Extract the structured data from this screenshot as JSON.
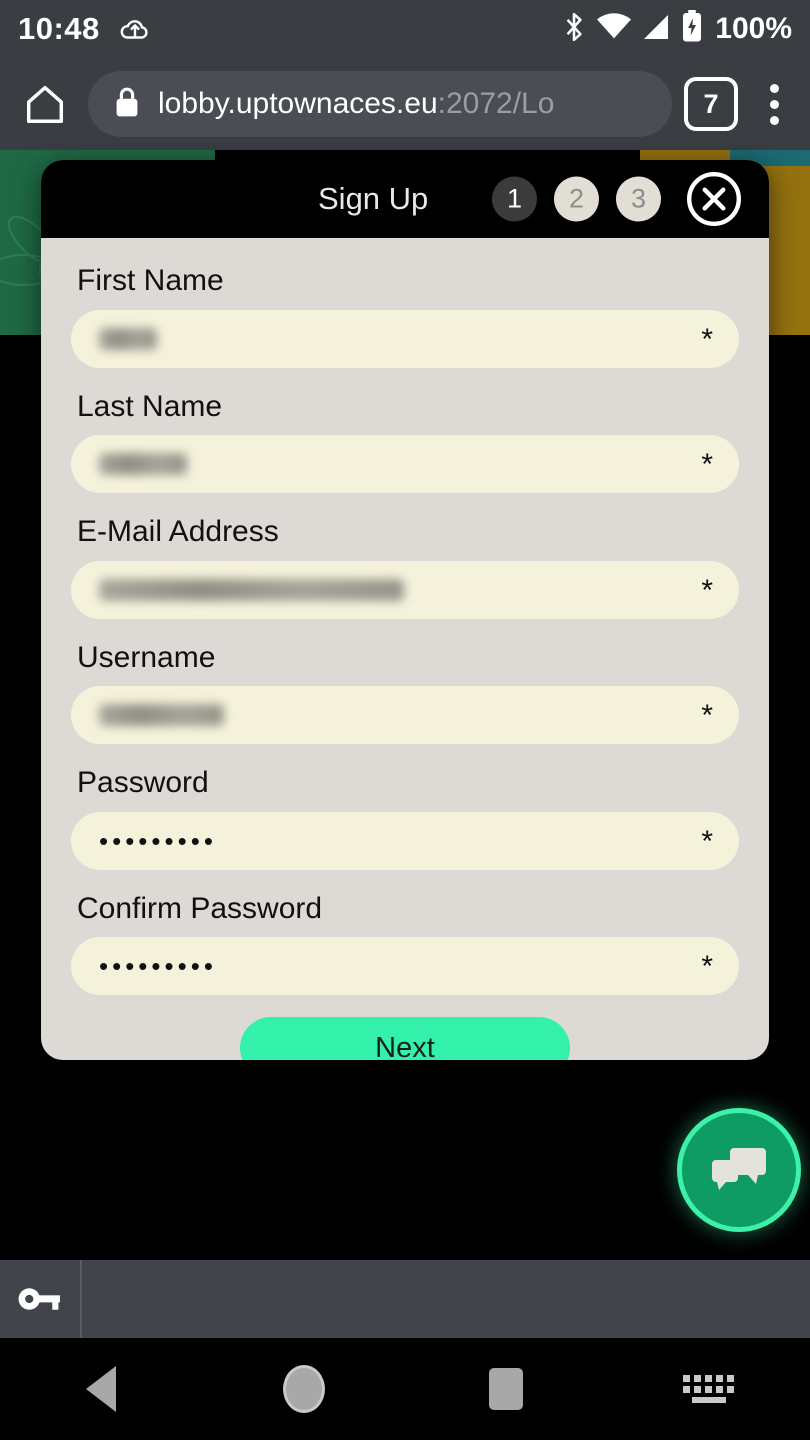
{
  "status_bar": {
    "time": "10:48",
    "battery_percent": "100%",
    "icons": [
      "cloud-upload-icon",
      "bluetooth-icon",
      "wifi-icon",
      "signal-icon",
      "battery-icon"
    ]
  },
  "browser": {
    "home_icon": "home-icon",
    "lock_icon": "lock-icon",
    "url_domain": "lobby.uptownaces.eu",
    "url_path": ":2072/Lo",
    "tab_count": "7",
    "menu_icon": "overflow-menu-icon"
  },
  "modal": {
    "title": "Sign Up",
    "steps": [
      {
        "label": "1",
        "state": "active"
      },
      {
        "label": "2",
        "state": "idle"
      },
      {
        "label": "3",
        "state": "idle"
      }
    ],
    "close_icon": "close-circle-icon",
    "required_marker": "*",
    "fields": [
      {
        "label": "First Name",
        "type": "blurred",
        "value": "",
        "blur_width": 58
      },
      {
        "label": "Last Name",
        "type": "blurred",
        "value": "",
        "blur_width": 88
      },
      {
        "label": "E-Mail Address",
        "type": "blurred",
        "value": "",
        "blur_width": 305
      },
      {
        "label": "Username",
        "type": "blurred",
        "value": "",
        "blur_width": 125
      },
      {
        "label": "Password",
        "type": "masked",
        "value": "•••••••••",
        "blur_width": 0
      },
      {
        "label": "Confirm Password",
        "type": "masked",
        "value": "•••••••••",
        "blur_width": 0
      }
    ],
    "next_label": "Next"
  },
  "chat_widget": {
    "icon": "chat-bubbles-icon"
  },
  "password_bar": {
    "icon": "key-icon"
  },
  "nav_bar": {
    "back": "back-icon",
    "home": "home-circle-icon",
    "recents": "recents-icon",
    "keyboard": "keyboard-icon"
  },
  "colors": {
    "accent_green": "#33f0ab",
    "chat_green": "#0f9c64",
    "modal_bg": "#ddd9d4",
    "input_bg": "#f5f2dc",
    "chrome_gray": "#3a3d42"
  }
}
